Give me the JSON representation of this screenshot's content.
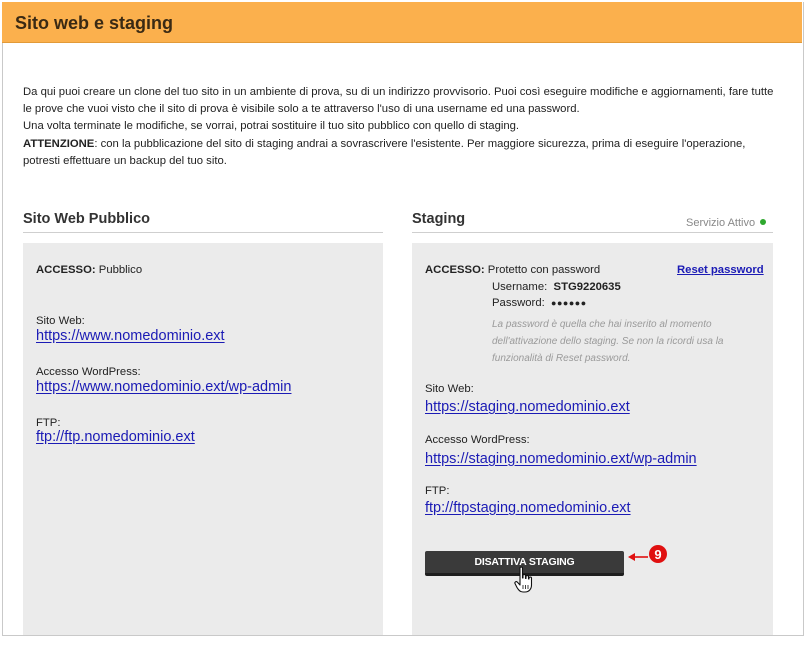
{
  "header": {
    "title": "Sito web e staging"
  },
  "intro": {
    "p1": "Da qui puoi creare un clone del tuo sito in un ambiente di prova, su di un indirizzo provvisorio. Puoi così eseguire modifiche e aggiornamenti, fare tutte le prove che vuoi visto che il sito di prova è visibile solo a te attraverso l'uso di una username ed una password.",
    "p2": "Una volta terminate le modifiche, se vorrai, potrai sostituire il tuo sito pubblico con quello di staging.",
    "warning_label": "ATTENZIONE",
    "warning_text": ": con la pubblicazione del sito di staging andrai a sovrascrivere l'esistente. Per maggiore sicurezza, prima di eseguire l'operazione, potresti effettuare un backup del tuo sito."
  },
  "public": {
    "title": "Sito Web Pubblico",
    "access_label": "ACCESSO:",
    "access_value": "Pubblico",
    "site_label": "Sito Web:",
    "site_url": "https://www.nomedominio.ext",
    "wp_label": "Accesso WordPress:",
    "wp_url": "https://www.nomedominio.ext/wp-admin",
    "ftp_label": "FTP:",
    "ftp_url": "ftp://ftp.nomedominio.ext"
  },
  "staging": {
    "title": "Staging",
    "status_text": "Servizio Attivo",
    "status_color": "#2ea82e",
    "access_label": "ACCESSO:",
    "access_value": "Protetto con password",
    "reset_link": "Reset password",
    "username_label": "Username:",
    "username_value": "STG9220635",
    "password_label": "Password:",
    "password_value": "●●●●●●",
    "note": "La password è quella che hai inserito al momento dell'attivazione dello staging. Se non la ricordi usa la funzionalità di Reset password.",
    "site_label": "Sito Web:",
    "site_url": "https://staging.nomedominio.ext",
    "wp_label": "Accesso WordPress:",
    "wp_url": "https://staging.nomedominio.ext/wp-admin",
    "ftp_label": "FTP:",
    "ftp_url": "ftp://ftpstaging.nomedominio.ext",
    "button_label": "DISATTIVA STAGING"
  },
  "callout": {
    "number": "9",
    "color": "#e01010"
  }
}
